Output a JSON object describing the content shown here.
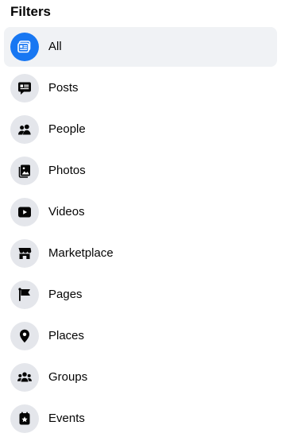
{
  "filters": {
    "heading": "Filters",
    "items": [
      {
        "label": "All",
        "icon": "all-results-icon",
        "active": true
      },
      {
        "label": "Posts",
        "icon": "posts-icon",
        "active": false
      },
      {
        "label": "People",
        "icon": "people-icon",
        "active": false
      },
      {
        "label": "Photos",
        "icon": "photos-icon",
        "active": false
      },
      {
        "label": "Videos",
        "icon": "videos-icon",
        "active": false
      },
      {
        "label": "Marketplace",
        "icon": "marketplace-icon",
        "active": false
      },
      {
        "label": "Pages",
        "icon": "pages-icon",
        "active": false
      },
      {
        "label": "Places",
        "icon": "places-icon",
        "active": false
      },
      {
        "label": "Groups",
        "icon": "groups-icon",
        "active": false
      },
      {
        "label": "Events",
        "icon": "events-icon",
        "active": false
      }
    ]
  },
  "colors": {
    "accent": "#1877f2",
    "icon_bg": "#e4e6eb",
    "active_row_bg": "#f0f2f5",
    "text": "#050505"
  }
}
